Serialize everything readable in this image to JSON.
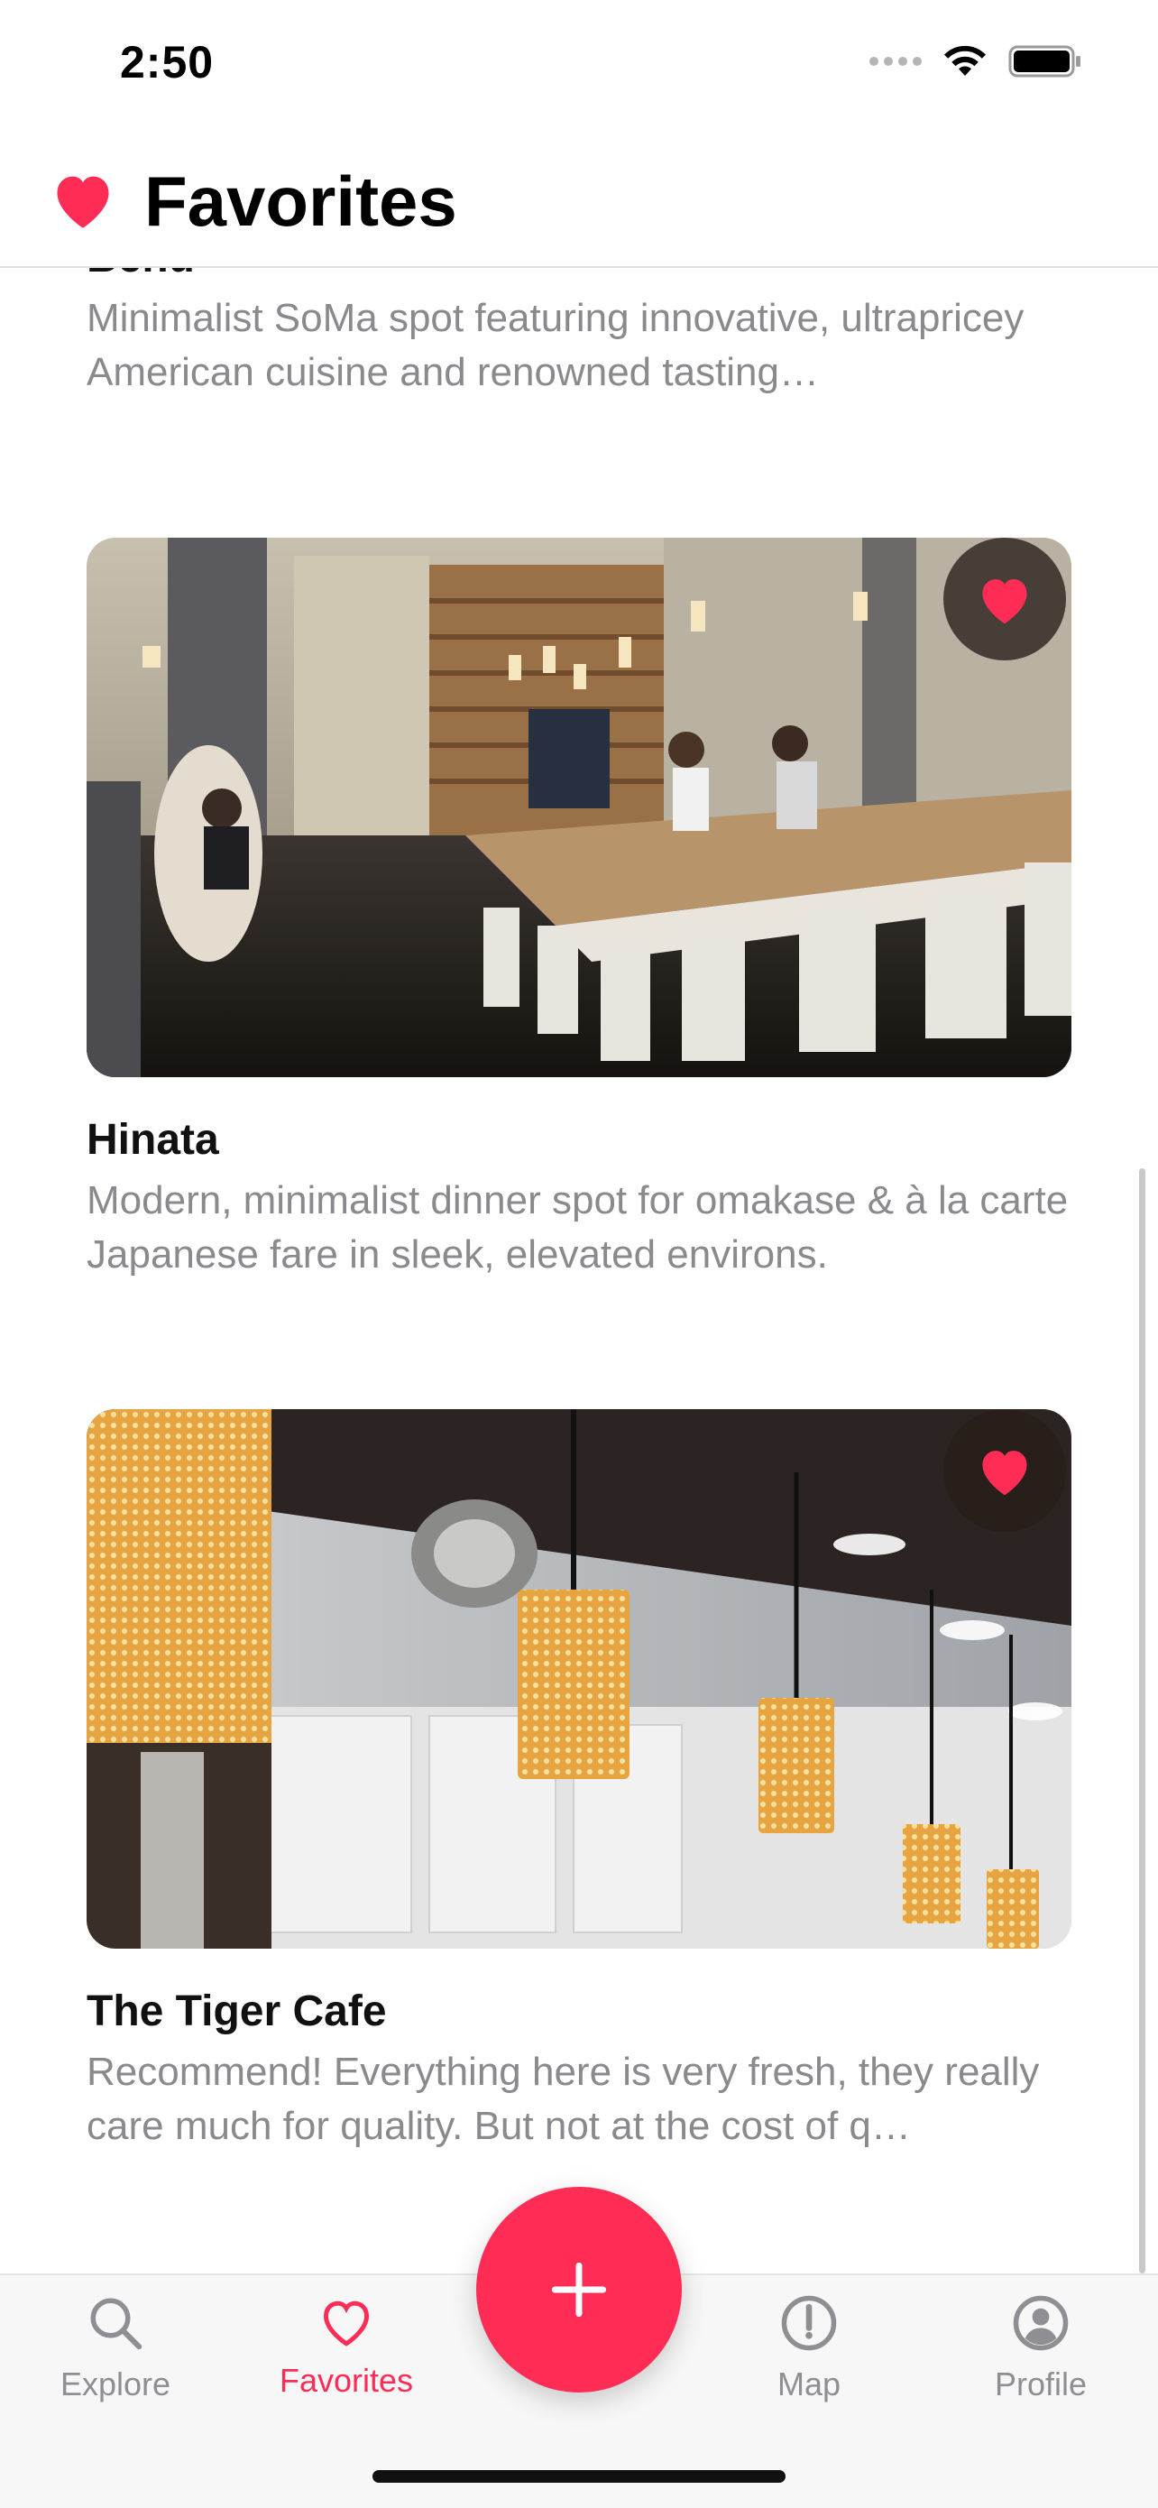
{
  "status_bar": {
    "time": "2:50"
  },
  "header": {
    "title": "Favorites"
  },
  "restaurants": [
    {
      "name": "Benu",
      "description": "Minimalist SoMa spot featuring innovative, ultrapricey American cuisine and renowned tasting…"
    },
    {
      "name": "Hinata",
      "description": "Modern, minimalist dinner spot for omakase & à la carte Japanese fare in sleek, elevated environs."
    },
    {
      "name": "The Tiger Cafe",
      "description": "Recommend! Everything here is very fresh, they really care much for quality. But not at the cost of q…"
    }
  ],
  "tabs": [
    {
      "label": "Explore",
      "icon": "search-icon",
      "active": false
    },
    {
      "label": "Favorites",
      "icon": "heart-outline-icon",
      "active": true
    },
    {
      "label": "Map",
      "icon": "compass-icon",
      "active": false
    },
    {
      "label": "Profile",
      "icon": "person-circle-icon",
      "active": false
    }
  ],
  "fab": {
    "icon": "plus-icon"
  },
  "colors": {
    "accent": "#ff2d55",
    "secondary_text": "#8a8a8e",
    "tab_inactive": "#8e8e93"
  }
}
